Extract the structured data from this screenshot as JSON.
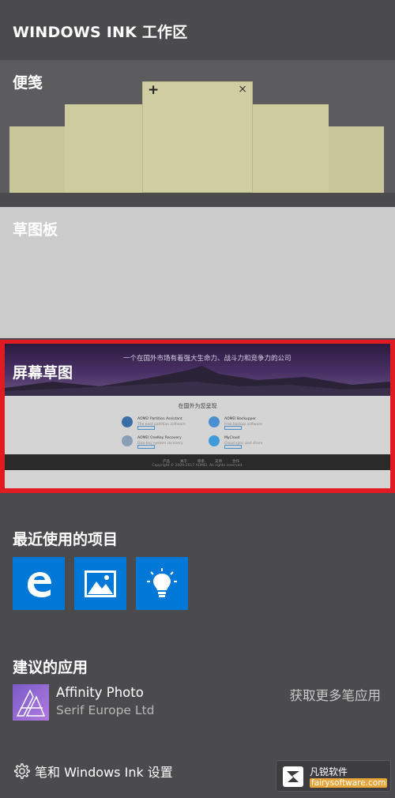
{
  "workspace": {
    "title": "WINDOWS INK 工作区"
  },
  "sticky_notes": {
    "label": "便笺",
    "plus_symbol": "+",
    "close_symbol": "×"
  },
  "sketchpad": {
    "label": "草图板"
  },
  "screen_sketch": {
    "label": "屏幕草图",
    "preview": {
      "hero_text": "一个在国外市场有着强大生命力、战斗力和竞争力的公司",
      "subtitle": "在国外为您呈现",
      "products": [
        {
          "name": "AOMEI Partition Assistant",
          "desc": "The best partition software",
          "color": "#3a6ea5"
        },
        {
          "name": "AOMEI Backupper",
          "desc": "Free backup software",
          "color": "#4a8fd0"
        },
        {
          "name": "AOMEI OneKey Recovery",
          "desc": "One-key system recovery",
          "color": "#8a9fb5"
        },
        {
          "name": "MyCloud",
          "desc": "Cloud sync and share",
          "color": "#3f9ad8"
        }
      ],
      "footer_links": [
        "产品",
        "关于",
        "联系",
        "支持",
        "合作"
      ],
      "copyright": "Copyright © 2009-2017 AOMEI. All rights reserved."
    }
  },
  "recent": {
    "label": "最近使用的项目",
    "items": [
      {
        "name": "edge-icon"
      },
      {
        "name": "photos-icon"
      },
      {
        "name": "tips-icon"
      }
    ]
  },
  "suggested": {
    "label": "建议的应用",
    "app_name": "Affinity Photo",
    "publisher": "Serif Europe Ltd",
    "more_link": "获取更多笔应用"
  },
  "settings": {
    "label": "笔和 Windows Ink 设置"
  },
  "watermark": {
    "name": "凡锐软件",
    "url": "fairysoftware.com"
  },
  "colors": {
    "accent_red": "#e11b22",
    "tile_blue": "#0078d7",
    "note_yellow": "#cecc9f"
  }
}
